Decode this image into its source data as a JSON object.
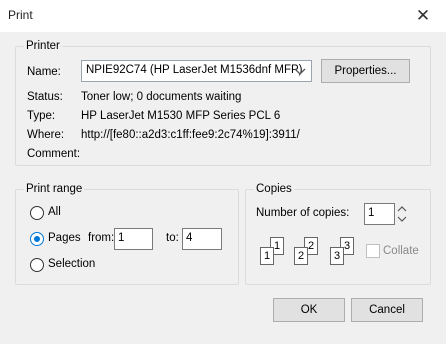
{
  "window": {
    "title": "Print",
    "close_glyph": "✕"
  },
  "printer": {
    "legend": "Printer",
    "name_label": "Name:",
    "name_value": "NPIE92C74 (HP LaserJet M1536dnf MFP)",
    "properties_button": "Properties...",
    "status_label": "Status:",
    "status_value": "Toner low; 0 documents waiting",
    "type_label": "Type:",
    "type_value": "HP LaserJet M1530 MFP Series PCL 6",
    "where_label": "Where:",
    "where_value": "http://[fe80::a2d3:c1ff:fee9:2c74%19]:3911/",
    "comment_label": "Comment:",
    "comment_value": ""
  },
  "print_range": {
    "legend": "Print range",
    "all_label": "All",
    "pages_label": "Pages",
    "from_label": "from:",
    "from_value": "1",
    "to_label": "to:",
    "to_value": "4",
    "selection_label": "Selection",
    "selected": "Pages"
  },
  "copies": {
    "legend": "Copies",
    "number_label": "Number of copies:",
    "number_value": "1",
    "collate_label": "Collate",
    "collate_checked": false,
    "collate_enabled": false,
    "stack_numbers": [
      "1",
      "1",
      "2",
      "2",
      "3",
      "3"
    ]
  },
  "buttons": {
    "ok": "OK",
    "cancel": "Cancel"
  },
  "colors": {
    "accent": "#0078d7",
    "window_bg": "#f0f0f0",
    "titlebar_bg": "#ffffff"
  }
}
